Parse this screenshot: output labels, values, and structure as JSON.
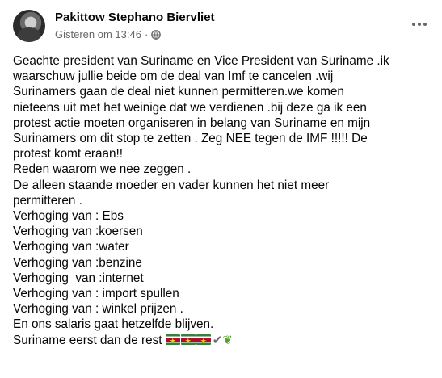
{
  "author": {
    "name": "Pakittow Stephano Biervliet",
    "timestamp": "Gisteren om 13:46",
    "separator": "·",
    "privacy_icon": "globe-icon"
  },
  "menu_icon": "more-options-icon",
  "post": {
    "lines": [
      "Geachte president van Suriname en Vice President van Suriname .ik",
      "waarschuw jullie beide om de deal van Imf te cancelen .wij",
      "Surinamers gaan de deal niet kunnen permitteren.we komen",
      "nieteens uit met het weinige dat we verdienen .bij deze ga ik een",
      "protest actie moeten organiseren in belang van Suriname en mijn",
      "Surinamers om dit stop te zetten . Zeg NEE tegen de IMF !!!!! De",
      "protest komt eraan!!",
      "Reden waarom we nee zeggen .",
      "De alleen staande moeder en vader kunnen het niet meer",
      "permitteren .",
      "Verhoging van : Ebs",
      "Verhoging van :koersen",
      "Verhoging van :water",
      "Verhoging van :benzine",
      "Verhoging  van :internet",
      "Verhoging van : import spullen",
      "Verhoging van : winkel prijzen .",
      "En ons salaris gaat hetzelfde blijven.",
      "Suriname eerst dan de rest"
    ],
    "trailing_emoji": [
      "suriname-flag-icon",
      "suriname-flag-icon",
      "suriname-flag-icon",
      "check-mark-icon",
      "herb-icon"
    ]
  }
}
